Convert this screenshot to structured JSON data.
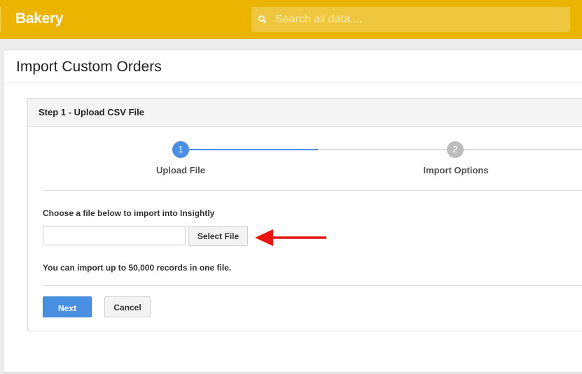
{
  "header": {
    "brand": "Bakery",
    "search_placeholder": "Search all data....",
    "search_icon": "search-icon"
  },
  "page": {
    "title": "Import Custom Orders"
  },
  "wizard": {
    "title": "Step 1 - Upload CSV File",
    "steps": [
      {
        "number": "1",
        "label": "Upload File",
        "active": true,
        "color": "#4a8ee6"
      },
      {
        "number": "2",
        "label": "Import Options",
        "active": false,
        "color": "#bdbdbd"
      }
    ],
    "progress_color": "#4a8ee6",
    "track_color": "#dddddd",
    "prompt": "Choose a file below to import into Insightly",
    "file_value": "",
    "select_button": "Select File",
    "limit_note": "You can import up to 50,000 records in one file.",
    "next_button": "Next",
    "cancel_button": "Cancel"
  },
  "annotation": {
    "arrow_color": "#e8140f",
    "arrow_icon": "left-arrow-icon"
  }
}
